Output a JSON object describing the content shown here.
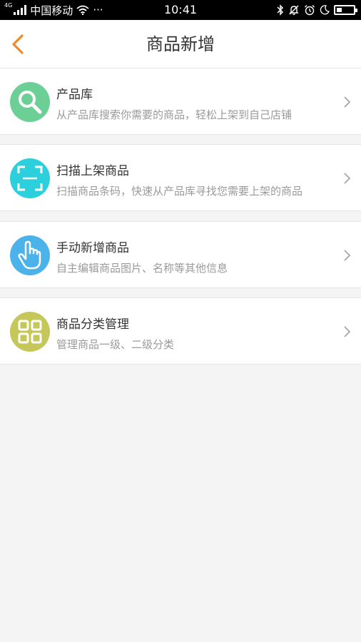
{
  "status_bar": {
    "network_type": "4G",
    "carrier": "中国移动",
    "more": "···",
    "time": "10:41",
    "battery_level": 0.3
  },
  "nav": {
    "title": "商品新增",
    "back_icon": "chevron-left-icon",
    "accent_color": "#f08a24"
  },
  "menu": [
    {
      "title": "产品库",
      "desc": "从产品库搜索你需要的商品，轻松上架到自己店铺",
      "icon": "search-icon",
      "color": "#6ccf95"
    },
    {
      "title": "扫描上架商品",
      "desc": "扫描商品条码，快速从产品库寻找您需要上架的商品",
      "icon": "scan-icon",
      "color": "#2ccfdc"
    },
    {
      "title": "手动新增商品",
      "desc": "自主编辑商品图片、名称等其他信息",
      "icon": "hand-pointer-icon",
      "color": "#4cb2ea"
    },
    {
      "title": "商品分类管理",
      "desc": "管理商品一级、二级分类",
      "icon": "grid-icon",
      "color": "#c5c75a"
    }
  ]
}
